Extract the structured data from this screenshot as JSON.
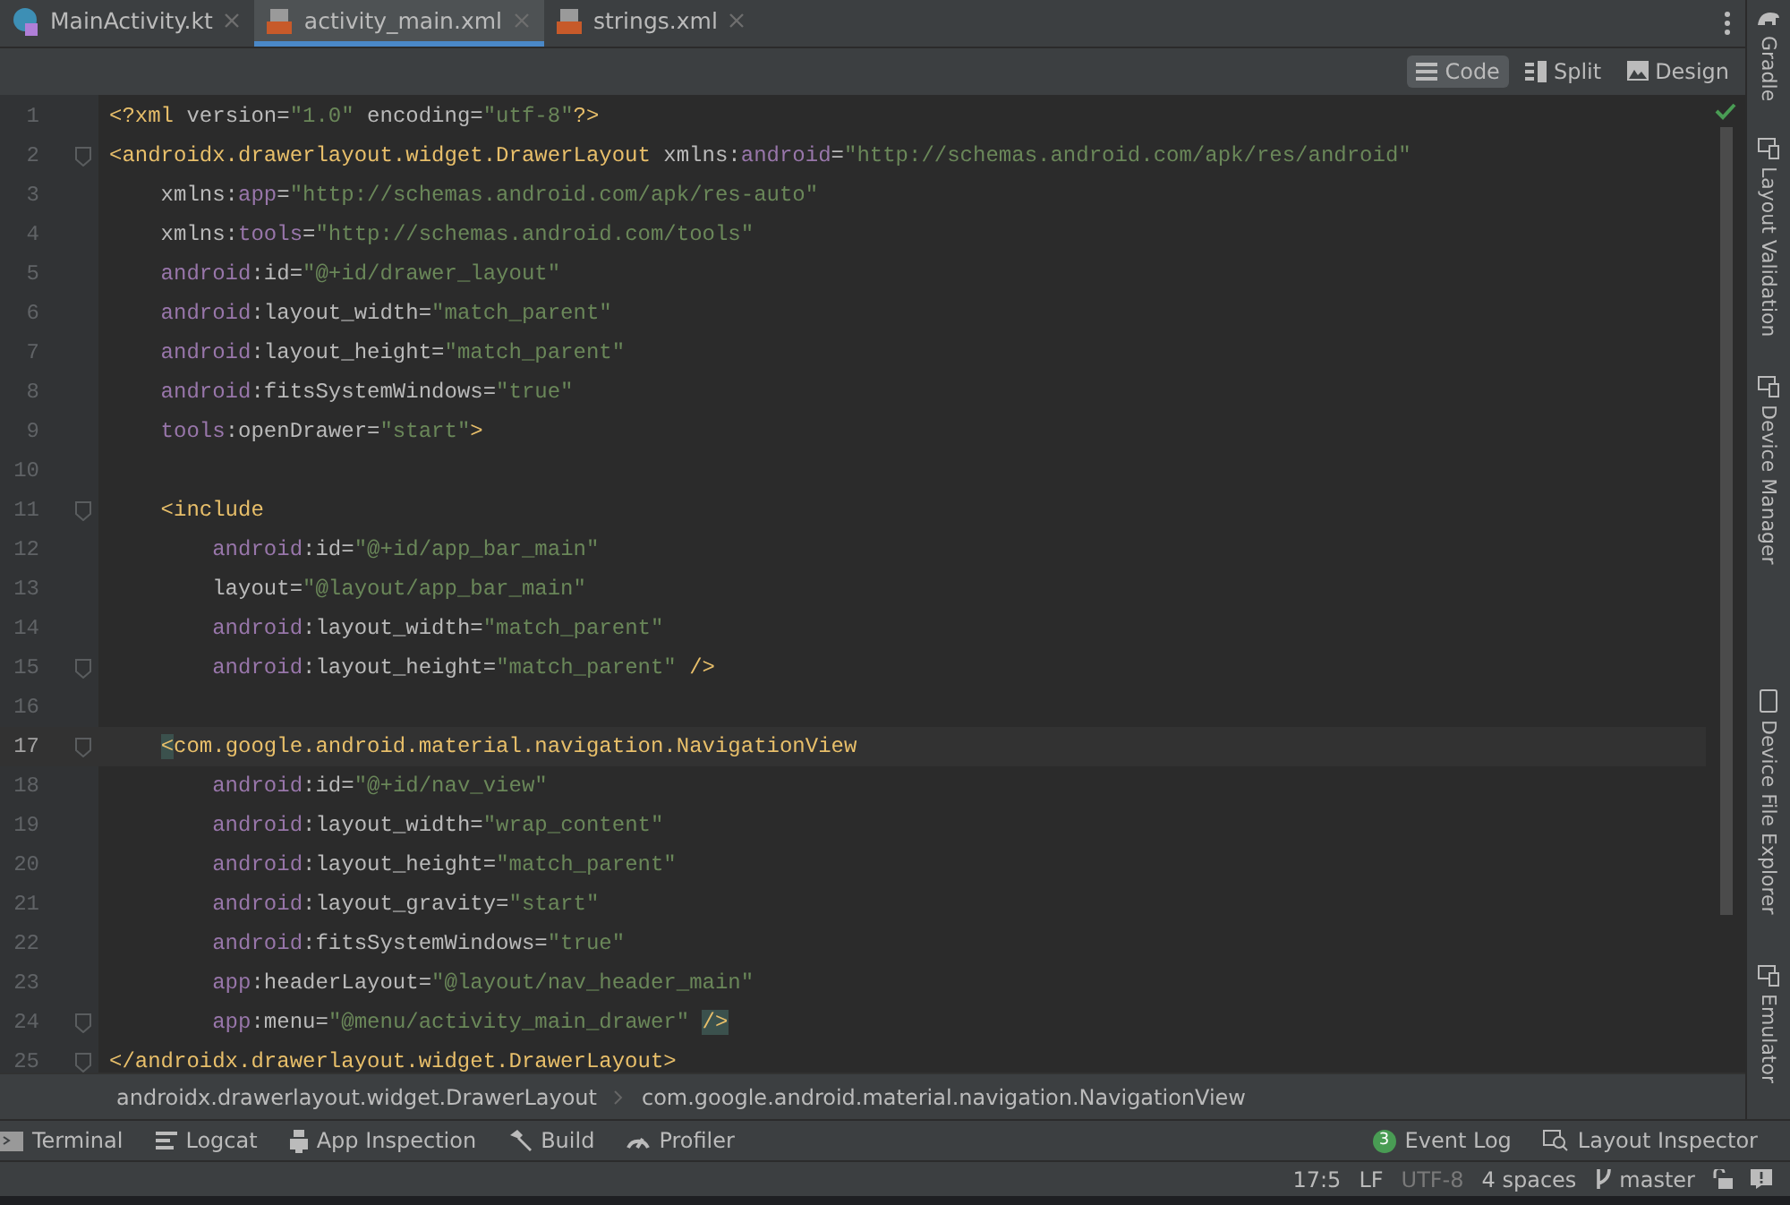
{
  "tabs": [
    {
      "label": "MainActivity.kt",
      "kind": "kotlin",
      "selected": false
    },
    {
      "label": "activity_main.xml",
      "kind": "xml",
      "selected": true
    },
    {
      "label": "strings.xml",
      "kind": "xml",
      "selected": false
    }
  ],
  "view_modes": [
    {
      "label": "Code",
      "kind": "code",
      "selected": true
    },
    {
      "label": "Split",
      "kind": "split",
      "selected": false
    },
    {
      "label": "Design",
      "kind": "design",
      "selected": false
    }
  ],
  "right_panels": [
    {
      "label": "Gradle",
      "kind": "gradle"
    },
    {
      "label": "Layout Validation",
      "kind": "device"
    },
    {
      "label": "Device Manager",
      "kind": "device"
    },
    {
      "label": "Device File Explorer",
      "kind": "phone"
    },
    {
      "label": "Emulator",
      "kind": "device"
    }
  ],
  "editor": {
    "lines": [
      {
        "number": "1",
        "current": false,
        "fold": false,
        "tokens": [
          {
            "t": "<?xml ",
            "kind": "tag"
          },
          {
            "t": "version=",
            "kind": "attr"
          },
          {
            "t": "\"1.0\"",
            "kind": "str"
          },
          {
            "t": " encoding=",
            "kind": "attr"
          },
          {
            "t": "\"utf-8\"",
            "kind": "str"
          },
          {
            "t": "?>",
            "kind": "tag"
          }
        ]
      },
      {
        "number": "2",
        "current": false,
        "fold": true,
        "tokens": [
          {
            "t": "<androidx.drawerlayout.widget.DrawerLayout ",
            "kind": "tag"
          },
          {
            "t": "xmlns:",
            "kind": "attr"
          },
          {
            "t": "android",
            "kind": "ns"
          },
          {
            "t": "=",
            "kind": "attr"
          },
          {
            "t": "\"http://schemas.android.com/apk/res/android\"",
            "kind": "str"
          }
        ]
      },
      {
        "number": "3",
        "current": false,
        "fold": false,
        "tokens": [
          {
            "t": "    xmlns:",
            "kind": "attr"
          },
          {
            "t": "app",
            "kind": "ns"
          },
          {
            "t": "=",
            "kind": "attr"
          },
          {
            "t": "\"http://schemas.android.com/apk/res-auto\"",
            "kind": "str"
          }
        ]
      },
      {
        "number": "4",
        "current": false,
        "fold": false,
        "tokens": [
          {
            "t": "    xmlns:",
            "kind": "attr"
          },
          {
            "t": "tools",
            "kind": "ns"
          },
          {
            "t": "=",
            "kind": "attr"
          },
          {
            "t": "\"http://schemas.android.com/tools\"",
            "kind": "str"
          }
        ]
      },
      {
        "number": "5",
        "current": false,
        "fold": false,
        "tokens": [
          {
            "t": "    android",
            "kind": "ns"
          },
          {
            "t": ":id=",
            "kind": "attr"
          },
          {
            "t": "\"@+id/drawer_layout\"",
            "kind": "str"
          }
        ]
      },
      {
        "number": "6",
        "current": false,
        "fold": false,
        "tokens": [
          {
            "t": "    android",
            "kind": "ns"
          },
          {
            "t": ":layout_width=",
            "kind": "attr"
          },
          {
            "t": "\"match_parent\"",
            "kind": "str"
          }
        ]
      },
      {
        "number": "7",
        "current": false,
        "fold": false,
        "tokens": [
          {
            "t": "    android",
            "kind": "ns"
          },
          {
            "t": ":layout_height=",
            "kind": "attr"
          },
          {
            "t": "\"match_parent\"",
            "kind": "str"
          }
        ]
      },
      {
        "number": "8",
        "current": false,
        "fold": false,
        "tokens": [
          {
            "t": "    android",
            "kind": "ns"
          },
          {
            "t": ":fitsSystemWindows=",
            "kind": "attr"
          },
          {
            "t": "\"true\"",
            "kind": "str"
          }
        ]
      },
      {
        "number": "9",
        "current": false,
        "fold": false,
        "tokens": [
          {
            "t": "    tools",
            "kind": "ns"
          },
          {
            "t": ":openDrawer=",
            "kind": "attr"
          },
          {
            "t": "\"start\"",
            "kind": "str"
          },
          {
            "t": ">",
            "kind": "tag"
          }
        ]
      },
      {
        "number": "10",
        "current": false,
        "fold": false
      },
      {
        "number": "11",
        "current": false,
        "fold": true,
        "tokens": [
          {
            "t": "    <include",
            "kind": "tag"
          }
        ]
      },
      {
        "number": "12",
        "current": false,
        "fold": false,
        "tokens": [
          {
            "t": "        android",
            "kind": "ns"
          },
          {
            "t": ":id=",
            "kind": "attr"
          },
          {
            "t": "\"@+id/app_bar_main\"",
            "kind": "str"
          }
        ]
      },
      {
        "number": "13",
        "current": false,
        "fold": false,
        "tokens": [
          {
            "t": "        layout=",
            "kind": "attr"
          },
          {
            "t": "\"@layout/app_bar_main\"",
            "kind": "str"
          }
        ]
      },
      {
        "number": "14",
        "current": false,
        "fold": false,
        "tokens": [
          {
            "t": "        android",
            "kind": "ns"
          },
          {
            "t": ":layout_width=",
            "kind": "attr"
          },
          {
            "t": "\"match_parent\"",
            "kind": "str"
          }
        ]
      },
      {
        "number": "15",
        "current": false,
        "fold": true,
        "tokens": [
          {
            "t": "        android",
            "kind": "ns"
          },
          {
            "t": ":layout_height=",
            "kind": "attr"
          },
          {
            "t": "\"match_parent\"",
            "kind": "str"
          },
          {
            "t": " />",
            "kind": "tag"
          }
        ]
      },
      {
        "number": "16",
        "current": false,
        "fold": false
      },
      {
        "number": "17",
        "current": true,
        "fold": true,
        "tokens": [
          {
            "t": "    <",
            "kind": "match"
          },
          {
            "t": "com.google.android.material.navigation.NavigationView",
            "kind": "tag"
          }
        ]
      },
      {
        "number": "18",
        "current": false,
        "fold": false,
        "tokens": [
          {
            "t": "        android",
            "kind": "ns"
          },
          {
            "t": ":id=",
            "kind": "attr"
          },
          {
            "t": "\"@+id/nav_view\"",
            "kind": "str"
          }
        ]
      },
      {
        "number": "19",
        "current": false,
        "fold": false,
        "tokens": [
          {
            "t": "        android",
            "kind": "ns"
          },
          {
            "t": ":layout_width=",
            "kind": "attr"
          },
          {
            "t": "\"wrap_content\"",
            "kind": "str"
          }
        ]
      },
      {
        "number": "20",
        "current": false,
        "fold": false,
        "tokens": [
          {
            "t": "        android",
            "kind": "ns"
          },
          {
            "t": ":layout_height=",
            "kind": "attr"
          },
          {
            "t": "\"match_parent\"",
            "kind": "str"
          }
        ]
      },
      {
        "number": "21",
        "current": false,
        "fold": false,
        "tokens": [
          {
            "t": "        android",
            "kind": "ns"
          },
          {
            "t": ":layout_gravity=",
            "kind": "attr"
          },
          {
            "t": "\"start\"",
            "kind": "str"
          }
        ]
      },
      {
        "number": "22",
        "current": false,
        "fold": false,
        "tokens": [
          {
            "t": "        android",
            "kind": "ns"
          },
          {
            "t": ":fitsSystemWindows=",
            "kind": "attr"
          },
          {
            "t": "\"true\"",
            "kind": "str"
          }
        ]
      },
      {
        "number": "23",
        "current": false,
        "fold": false,
        "tokens": [
          {
            "t": "        app",
            "kind": "ns"
          },
          {
            "t": ":headerLayout=",
            "kind": "attr"
          },
          {
            "t": "\"@layout/nav_header_main\"",
            "kind": "str"
          }
        ]
      },
      {
        "number": "24",
        "current": false,
        "fold": true,
        "tokens": [
          {
            "t": "        app",
            "kind": "ns"
          },
          {
            "t": ":menu=",
            "kind": "attr"
          },
          {
            "t": "\"@menu/activity_main_drawer\" ",
            "kind": "str"
          },
          {
            "t": "/>",
            "kind": "match"
          }
        ]
      },
      {
        "number": "25",
        "current": false,
        "fold": true,
        "tokens": [
          {
            "t": "</androidx.drawerlayout.widget.DrawerLayout>",
            "kind": "tag"
          }
        ]
      }
    ]
  },
  "breadcrumbs": [
    "androidx.drawerlayout.widget.DrawerLayout",
    "com.google.android.material.navigation.NavigationView"
  ],
  "tool_windows_left": [
    {
      "label": "Terminal",
      "kind": "terminal"
    },
    {
      "label": "Logcat",
      "kind": "logcat"
    },
    {
      "label": "App Inspection",
      "kind": "inspect"
    },
    {
      "label": "Build",
      "kind": "build"
    },
    {
      "label": "Profiler",
      "kind": "profiler"
    }
  ],
  "tool_windows_right": [
    {
      "label": "Event Log",
      "badge": "3"
    },
    {
      "label": "Layout Inspector",
      "kind": "layout"
    }
  ],
  "status_bar": {
    "position": "17:5",
    "line_separator": "LF",
    "encoding": "UTF-8",
    "indent": "4 spaces",
    "branch": "master"
  }
}
